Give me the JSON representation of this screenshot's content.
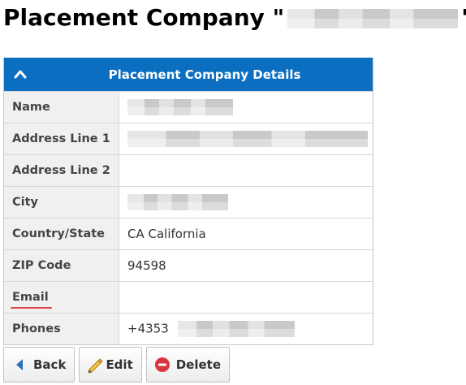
{
  "page": {
    "title_prefix": "Placement Company \"",
    "title_suffix": "\""
  },
  "panel": {
    "title": "Placement Company Details",
    "rows": [
      {
        "label": "Name",
        "value": ""
      },
      {
        "label": "Address Line 1",
        "value": ""
      },
      {
        "label": "Address Line 2",
        "value": ""
      },
      {
        "label": "City",
        "value": ""
      },
      {
        "label": "Country/State",
        "value": "CA California"
      },
      {
        "label": "ZIP Code",
        "value": "94598"
      },
      {
        "label": "Email",
        "value": ""
      },
      {
        "label": "Phones",
        "value": "+4353"
      }
    ]
  },
  "actions": {
    "back": "Back",
    "edit": "Edit",
    "delete": "Delete"
  },
  "colors": {
    "header_blue": "#0b6ec0",
    "label_bg": "#f0f0f0",
    "email_underline": "#e0434c",
    "back_arrow": "#2b6fbf",
    "delete_red": "#d9363e"
  },
  "icons": {
    "collapse": "chevron-up-icon",
    "back": "back-arrow-icon",
    "edit": "pencil-icon",
    "delete": "minus-circle-icon"
  }
}
